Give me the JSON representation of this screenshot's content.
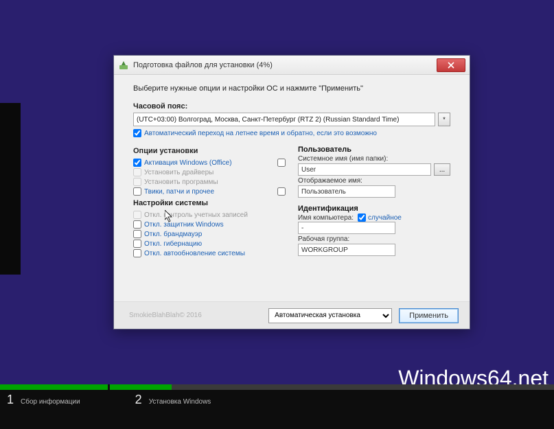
{
  "watermark": "Windows64.net",
  "progress": {
    "step1_num": "1",
    "step1_label": "Сбор информации",
    "step2_num": "2",
    "step2_label": "Установка Windows"
  },
  "dialog": {
    "title": "Подготовка файлов для установки (4%)",
    "instruction": "Выберите нужные опции и настройки ОС и нажмите \"Применить\"",
    "tz_label": "Часовой пояс:",
    "tz_value": "(UTC+03:00) Волгоград, Москва, Санкт-Петербург (RTZ 2) (Russian Standard Time)",
    "tz_auto": "Автоматический переход на летнее время и обратно, если это возможно",
    "install_title": "Опции установки",
    "install": {
      "activate": "Активация Windows (Office)",
      "drivers": "Установить драйверы",
      "programs": "Установить программы",
      "tweaks": "Твики, патчи и прочее"
    },
    "sys_title": "Настройки системы",
    "sys": {
      "uac": "Откл. контроль учетных записей",
      "defender": "Откл. защитник Windows",
      "firewall": "Откл. брандмауэр",
      "hiber": "Откл. гибернацию",
      "autoupdate": "Откл. автообновление системы"
    },
    "user_title": "Пользователь",
    "user": {
      "sysname_label": "Системное имя (имя папки):",
      "sysname_value": "User",
      "dispname_label": "Отображаемое имя:",
      "dispname_value": "Пользователь"
    },
    "ident_title": "Идентификация",
    "ident": {
      "comp_label": "Имя компьютера:",
      "random": "случайное",
      "comp_value": "-",
      "wg_label": "Рабочая группа:",
      "wg_value": "WORKGROUP"
    },
    "copy": "SmokieBlahBlah© 2016",
    "mode": "Автоматическая установка",
    "apply": "Применить"
  }
}
